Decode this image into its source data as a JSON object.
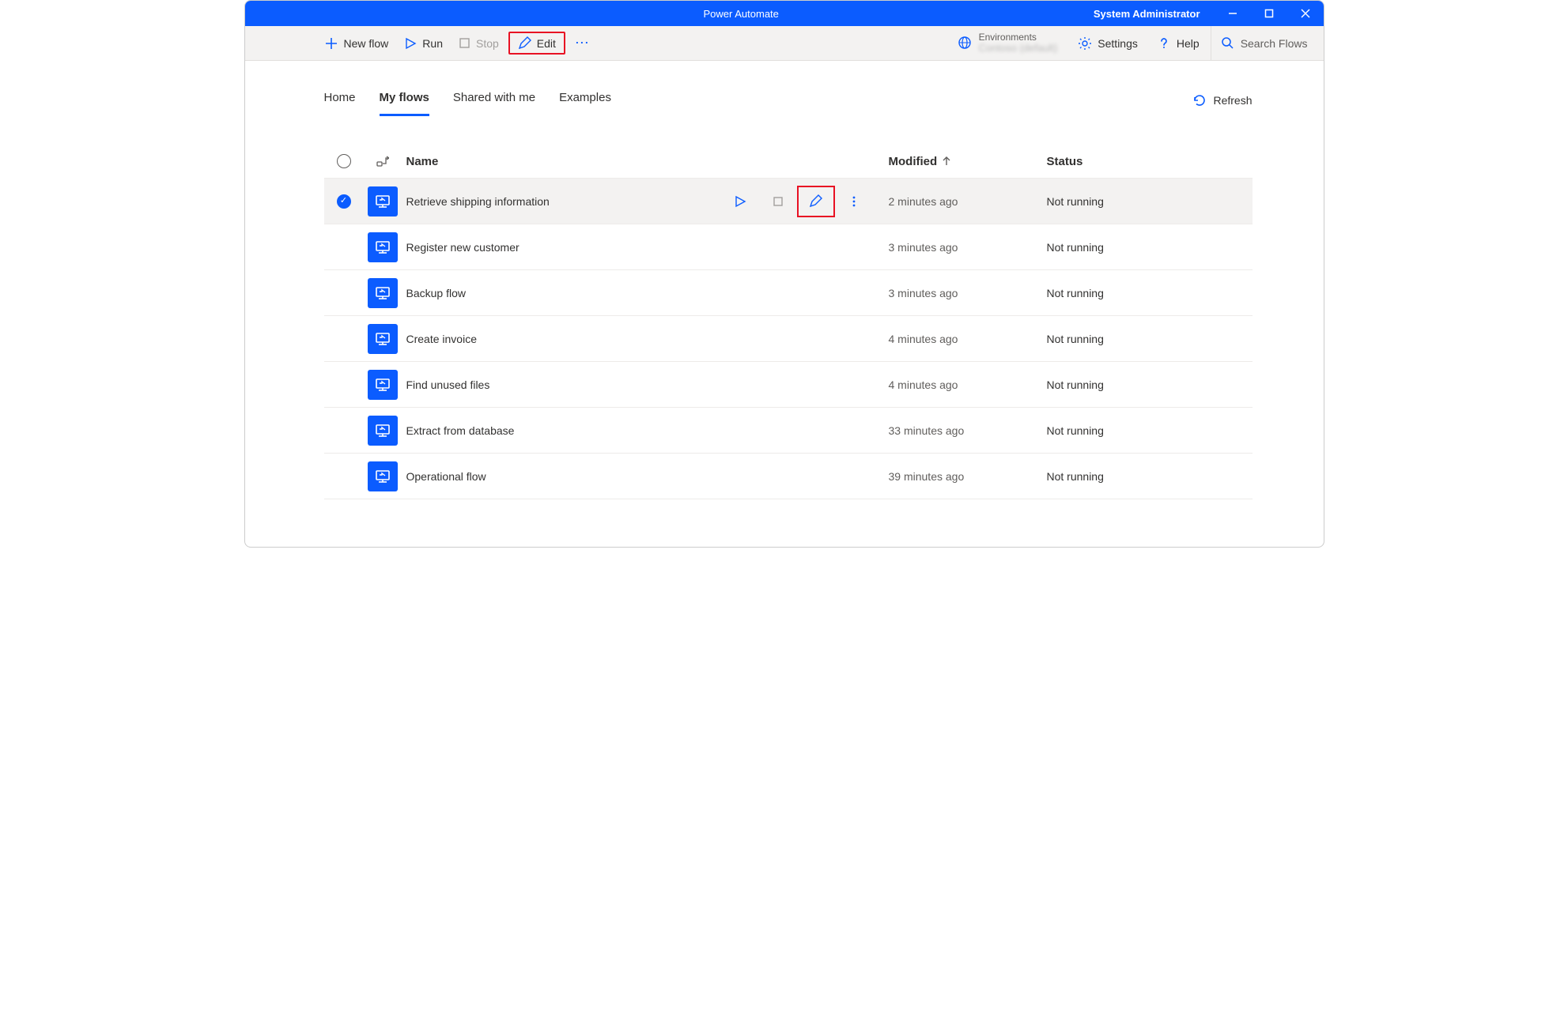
{
  "titlebar": {
    "app_title": "Power Automate",
    "user": "System Administrator"
  },
  "ribbon": {
    "new_flow": "New flow",
    "run": "Run",
    "stop": "Stop",
    "edit": "Edit",
    "environments_label": "Environments",
    "environments_value": "Contoso (default)",
    "settings": "Settings",
    "help": "Help",
    "search_placeholder": "Search Flows"
  },
  "tabs": {
    "home": "Home",
    "my_flows": "My flows",
    "shared": "Shared with me",
    "examples": "Examples"
  },
  "refresh_label": "Refresh",
  "columns": {
    "name": "Name",
    "modified": "Modified",
    "status": "Status"
  },
  "rows": [
    {
      "name": "Retrieve shipping information",
      "modified": "2 minutes ago",
      "status": "Not running",
      "selected": true
    },
    {
      "name": "Register new customer",
      "modified": "3 minutes ago",
      "status": "Not running",
      "selected": false
    },
    {
      "name": "Backup flow",
      "modified": "3 minutes ago",
      "status": "Not running",
      "selected": false
    },
    {
      "name": "Create invoice",
      "modified": "4 minutes ago",
      "status": "Not running",
      "selected": false
    },
    {
      "name": "Find unused files",
      "modified": "4 minutes ago",
      "status": "Not running",
      "selected": false
    },
    {
      "name": "Extract from database",
      "modified": "33 minutes ago",
      "status": "Not running",
      "selected": false
    },
    {
      "name": "Operational flow",
      "modified": "39 minutes ago",
      "status": "Not running",
      "selected": false
    }
  ]
}
